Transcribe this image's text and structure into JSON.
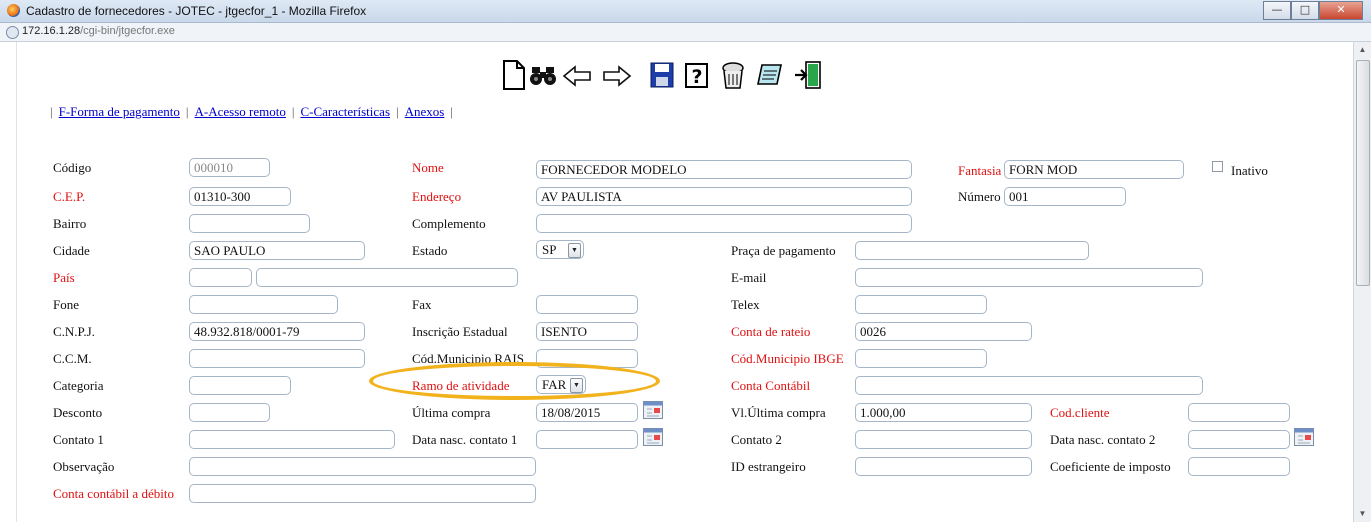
{
  "window": {
    "title": "Cadastro de fornecedores - JOTEC - jtgecfor_1 - Mozilla Firefox",
    "url_host": "172.16.1.28",
    "url_path": "/cgi-bin/jtgecfor.exe"
  },
  "toolbar": [
    "new-document-icon",
    "search-binoculars-icon",
    "arrow-left-icon",
    "arrow-right-icon",
    "save-floppy-icon",
    "help-icon",
    "delete-trash-icon",
    "notes-icon",
    "exit-door-icon"
  ],
  "menu": {
    "forma_pagamento": "F-Forma de pagamento",
    "acesso_remoto": "A-Acesso remoto",
    "caracteristicas": "C-Características",
    "anexos": "Anexos"
  },
  "labels": {
    "codigo": "Código",
    "nome": "Nome",
    "fantasia": "Fantasia",
    "inativo": "Inativo",
    "cep": "C.E.P.",
    "endereco": "Endereço",
    "numero": "Número",
    "bairro": "Bairro",
    "complemento": "Complemento",
    "cidade": "Cidade",
    "estado": "Estado",
    "praca": "Praça de pagamento",
    "pais": "País",
    "email": "E-mail",
    "fone": "Fone",
    "fax": "Fax",
    "telex": "Telex",
    "cnpj": "C.N.P.J.",
    "inscricao": "Inscrição Estadual",
    "conta_rateio": "Conta de rateio",
    "ccm": "C.C.M.",
    "cod_rais": "Cód.Municipio RAIS",
    "cod_ibge": "Cód.Municipio IBGE",
    "categoria": "Categoria",
    "ramo": "Ramo de atividade",
    "conta_contabil": "Conta Contábil",
    "desconto": "Desconto",
    "ultima_compra": "Última compra",
    "vl_ultima": "Vl.Última compra",
    "cod_cliente": "Cod.cliente",
    "contato1": "Contato 1",
    "data_nasc1": "Data nasc. contato 1",
    "contato2": "Contato 2",
    "data_nasc2": "Data nasc. contato 2",
    "observacao": "Observação",
    "id_estrangeiro": "ID estrangeiro",
    "coeficiente": "Coeficiente de imposto",
    "conta_debito": "Conta contábil a débito"
  },
  "values": {
    "codigo": "000010",
    "nome": "FORNECEDOR MODELO",
    "fantasia": "FORN MOD",
    "cep": "01310-300",
    "endereco": "AV PAULISTA",
    "numero": "001",
    "cidade": "SAO PAULO",
    "estado": "SP",
    "cnpj": "48.932.818/0001-79",
    "inscricao": "ISENTO",
    "conta_rateio": "0026",
    "ramo": "FAR",
    "ultima_compra": "18/08/2015",
    "vl_ultima": "1.000,00"
  },
  "colors": {
    "required_label": "#e01010",
    "link": "#0000cc",
    "highlight_ring": "#f2b21c"
  }
}
